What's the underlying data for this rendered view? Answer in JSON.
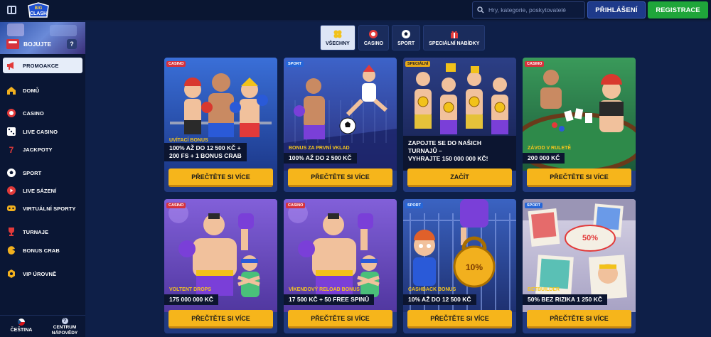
{
  "header": {
    "logo_text": "BIG CLASH",
    "search_placeholder": "Hry, kategorie, poskytovatelé",
    "login_label": "PŘIHLÁŠENÍ",
    "register_label": "REGISTRACE"
  },
  "sidebar": {
    "fight_label": "BOJUJTE",
    "help_label": "?",
    "items": [
      {
        "label": "PROMOAKCE",
        "icon": "megaphone-icon",
        "active": true
      },
      {
        "label": "DOMŮ",
        "icon": "home-icon"
      },
      {
        "label": "CASINO",
        "icon": "casino-chip-icon"
      },
      {
        "label": "LIVE CASINO",
        "icon": "dice-icon"
      },
      {
        "label": "JACKPOTY",
        "icon": "jackpot-icon"
      },
      {
        "label": "SPORT",
        "icon": "soccer-ball-icon"
      },
      {
        "label": "LIVE SÁZENÍ",
        "icon": "live-play-icon"
      },
      {
        "label": "VIRTUÁLNÍ SPORTY",
        "icon": "virtual-sports-icon"
      },
      {
        "label": "TURNAJE",
        "icon": "trophy-icon"
      },
      {
        "label": "BONUS CRAB",
        "icon": "crab-claw-icon"
      },
      {
        "label": "VIP ÚROVNĚ",
        "icon": "vip-coin-icon"
      }
    ],
    "footer": {
      "language_label": "ČEŠTINA",
      "help_center_label": "CENTRUM NÁPOVĚDY"
    }
  },
  "tabs": [
    {
      "label": "VŠECHNY",
      "icon": "clover-icon",
      "active": true
    },
    {
      "label": "CASINO",
      "icon": "casino-chip-icon"
    },
    {
      "label": "SPORT",
      "icon": "soccer-ball-icon"
    },
    {
      "label": "SPECIÁLNÍ NABÍDKY",
      "icon": "gift-icon"
    }
  ],
  "cta_label": "PŘEČTĚTE SI VÍCE",
  "promos": [
    {
      "badge": "CASINO",
      "badge_type": "casino",
      "category": "UVÍTACÍ BONUS",
      "headline_lines": [
        "100% AŽ DO 12 500 KČ +",
        "200 FS + 1 BONUS CRAB"
      ],
      "cta": "PŘEČTĚTE SI VÍCE",
      "art": "fighters"
    },
    {
      "badge": "SPORT",
      "badge_type": "sport",
      "category": "BONUS ZA PRVNÍ VKLAD",
      "headline_lines": [
        "100% AŽ DO 2 500 KČ"
      ],
      "cta": "PŘEČTĚTE SI VÍCE",
      "art": "soccer"
    },
    {
      "badge": "SPECIÁLNÍ",
      "badge_type": "special",
      "category": "",
      "headline_lines": [
        "ZAPOJTE SE DO NAŠICH",
        "TURNAJŮ –",
        "VYHRAJTE 150 000 000 KČ!"
      ],
      "cta": "ZAČÍT",
      "art": "champions"
    },
    {
      "badge": "CASINO",
      "badge_type": "casino",
      "category": "ZÁVOD V RULETĚ",
      "headline_lines": [
        "200 000 KČ"
      ],
      "cta": "PŘEČTĚTE SI VÍCE",
      "art": "poker"
    },
    {
      "badge": "CASINO",
      "badge_type": "casino",
      "category": "VOLTENT DROPS",
      "headline_lines": [
        "175 000 000 KČ"
      ],
      "cta": "PŘEČTĚTE SI VÍCE",
      "art": "boxer"
    },
    {
      "badge": "CASINO",
      "badge_type": "casino",
      "category": "VÍKENDOVÝ RELOAD BONUS",
      "headline_lines": [
        "17 500 KČ + 50 FREE SPINŮ"
      ],
      "cta": "PŘEČTĚTE SI VÍCE",
      "art": "boxer"
    },
    {
      "badge": "SPORT",
      "badge_type": "sport",
      "category": "CASHBACK BONUS",
      "headline_lines": [
        "10% AŽ DO 12 500 KČ"
      ],
      "cta": "PŘEČTĚTE SI VÍCE",
      "art": "kettlebell",
      "art_text": "10%"
    },
    {
      "badge": "SPORT",
      "badge_type": "sport",
      "category": "BETBUILDER",
      "headline_lines": [
        "50% BEZ RIZIKA 1 250 KČ"
      ],
      "cta": "PŘEČTĚTE SI VÍCE",
      "art": "photos",
      "art_text": "50%"
    }
  ],
  "colors": {
    "background": "#0e1f48",
    "cta_yellow": "#f6b51b",
    "category_yellow": "#f6c61c",
    "register_green": "#1fa53a",
    "login_blue": "#1e3a8a",
    "casino_badge": "#d6323c",
    "sport_badge": "#2566d8"
  }
}
